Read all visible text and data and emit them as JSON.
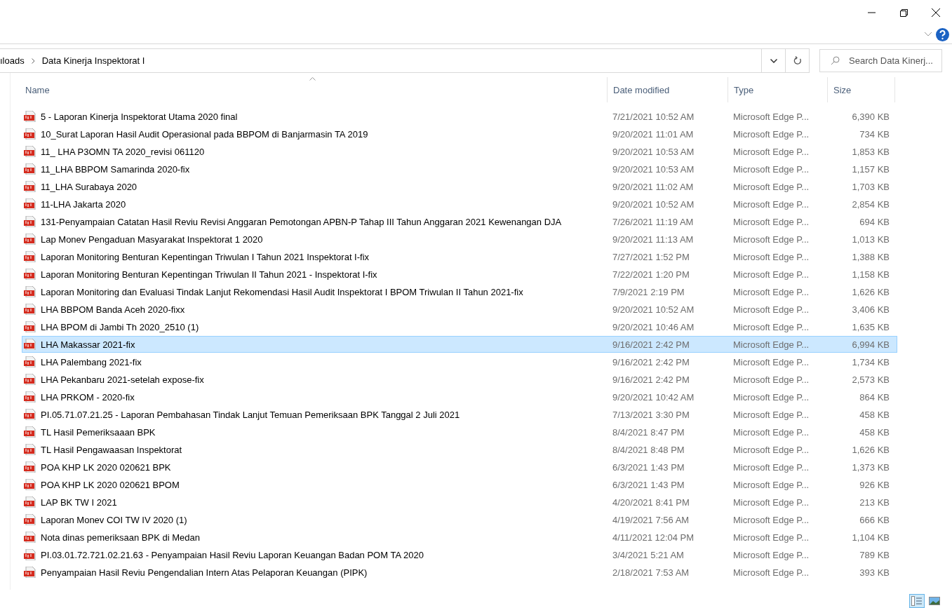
{
  "address_bar": {
    "path": [
      {
        "label": "ıloads"
      },
      {
        "label": "Data Kinerja Inspektorat I"
      }
    ]
  },
  "search": {
    "placeholder": "Search Data Kinerj..."
  },
  "table": {
    "columns": [
      "Name",
      "Date modified",
      "Type",
      "Size"
    ],
    "rows": [
      {
        "name": "5 - Laporan Kinerja Inspektorat Utama 2020 final",
        "date": "7/21/2021 10:52 AM",
        "type": "Microsoft Edge P...",
        "size": "6,390 KB",
        "selected": false
      },
      {
        "name": "10_Surat Laporan Hasil Audit Operasional pada BBPOM di Banjarmasin TA 2019",
        "date": "9/20/2021 11:01 AM",
        "type": "Microsoft Edge P...",
        "size": "734 KB",
        "selected": false
      },
      {
        "name": "11_ LHA P3OMN TA 2020_revisi 061120",
        "date": "9/20/2021 10:53 AM",
        "type": "Microsoft Edge P...",
        "size": "1,853 KB",
        "selected": false
      },
      {
        "name": "11_LHA BBPOM Samarinda 2020-fix",
        "date": "9/20/2021 10:53 AM",
        "type": "Microsoft Edge P...",
        "size": "1,157 KB",
        "selected": false
      },
      {
        "name": "11_LHA Surabaya 2020",
        "date": "9/20/2021 11:02 AM",
        "type": "Microsoft Edge P...",
        "size": "1,703 KB",
        "selected": false
      },
      {
        "name": "11-LHA Jakarta 2020",
        "date": "9/20/2021 10:52 AM",
        "type": "Microsoft Edge P...",
        "size": "2,854 KB",
        "selected": false
      },
      {
        "name": "131-Penyampaian Catatan Hasil Reviu Revisi Anggaran Pemotongan APBN-P Tahap III Tahun Anggaran 2021 Kewenangan DJA",
        "date": "7/26/2021 11:19 AM",
        "type": "Microsoft Edge P...",
        "size": "694 KB",
        "selected": false
      },
      {
        "name": "Lap Monev Pengaduan Masyarakat Inspektorat 1 2020",
        "date": "9/20/2021 11:13 AM",
        "type": "Microsoft Edge P...",
        "size": "1,013 KB",
        "selected": false
      },
      {
        "name": "Laporan Monitoring Benturan Kepentingan Triwulan I Tahun 2021 Inspektorat I-fix",
        "date": "7/27/2021 1:52 PM",
        "type": "Microsoft Edge P...",
        "size": "1,388 KB",
        "selected": false
      },
      {
        "name": "Laporan Monitoring Benturan Kepentingan Triwulan II Tahun 2021 - Inspektorat I-fix",
        "date": "7/22/2021 1:20 PM",
        "type": "Microsoft Edge P...",
        "size": "1,158 KB",
        "selected": false
      },
      {
        "name": "Laporan Monitoring dan Evaluasi Tindak Lanjut Rekomendasi Hasil Audit Inspektorat I BPOM Triwulan II Tahun 2021-fix",
        "date": "7/9/2021 2:19 PM",
        "type": "Microsoft Edge P...",
        "size": "1,626 KB",
        "selected": false
      },
      {
        "name": "LHA BBPOM Banda Aceh 2020-fixx",
        "date": "9/20/2021 10:52 AM",
        "type": "Microsoft Edge P...",
        "size": "3,406 KB",
        "selected": false
      },
      {
        "name": "LHA BPOM di Jambi Th 2020_2510 (1)",
        "date": "9/20/2021 10:46 AM",
        "type": "Microsoft Edge P...",
        "size": "1,635 KB",
        "selected": false
      },
      {
        "name": "LHA Makassar 2021-fix",
        "date": "9/16/2021 2:42 PM",
        "type": "Microsoft Edge P...",
        "size": "6,994 KB",
        "selected": true
      },
      {
        "name": "LHA Palembang 2021-fix",
        "date": "9/16/2021 2:42 PM",
        "type": "Microsoft Edge P...",
        "size": "1,734 KB",
        "selected": false
      },
      {
        "name": "LHA Pekanbaru 2021-setelah expose-fix",
        "date": "9/16/2021 2:42 PM",
        "type": "Microsoft Edge P...",
        "size": "2,573 KB",
        "selected": false
      },
      {
        "name": "LHA PRKOM - 2020-fix",
        "date": "9/20/2021 10:42 AM",
        "type": "Microsoft Edge P...",
        "size": "864 KB",
        "selected": false
      },
      {
        "name": "PI.05.71.07.21.25 - Laporan Pembahasan Tindak Lanjut Temuan Pemeriksaan BPK Tanggal 2 Juli 2021",
        "date": "7/13/2021 3:30 PM",
        "type": "Microsoft Edge P...",
        "size": "458 KB",
        "selected": false
      },
      {
        "name": "TL Hasil Pemeriksaaan BPK",
        "date": "8/4/2021 8:47 PM",
        "type": "Microsoft Edge P...",
        "size": "458 KB",
        "selected": false
      },
      {
        "name": "TL Hasil Pengawaasan Inspektorat",
        "date": "8/4/2021 8:48 PM",
        "type": "Microsoft Edge P...",
        "size": "1,626 KB",
        "selected": false
      },
      {
        "name": "POA KHP LK 2020 020621 BPK",
        "date": "6/3/2021 1:43 PM",
        "type": "Microsoft Edge P...",
        "size": "1,373 KB",
        "selected": false
      },
      {
        "name": "POA KHP LK 2020 020621 BPOM",
        "date": "6/3/2021 1:43 PM",
        "type": "Microsoft Edge P...",
        "size": "926 KB",
        "selected": false
      },
      {
        "name": "LAP BK TW I 2021",
        "date": "4/20/2021 8:41 PM",
        "type": "Microsoft Edge P...",
        "size": "213 KB",
        "selected": false
      },
      {
        "name": "Laporan Monev COI TW IV 2020 (1)",
        "date": "4/19/2021 7:56 AM",
        "type": "Microsoft Edge P...",
        "size": "666 KB",
        "selected": false
      },
      {
        "name": "Nota dinas pemeriksaan BPK di Medan",
        "date": "4/11/2021 12:04 PM",
        "type": "Microsoft Edge P...",
        "size": "1,104 KB",
        "selected": false
      },
      {
        "name": "PI.03.01.72.721.02.21.63 - Penyampaian Hasil Reviu Laporan Keuangan Badan POM TA 2020",
        "date": "3/4/2021 5:21 AM",
        "type": "Microsoft Edge P...",
        "size": "789 KB",
        "selected": false
      },
      {
        "name": "Penyampaian Hasil Reviu Pengendalian Intern Atas Pelaporan Keuangan (PIPK)",
        "date": "2/18/2021 7:53 AM",
        "type": "Microsoft Edge P...",
        "size": "393 KB",
        "selected": false
      }
    ]
  },
  "view_buttons": [
    {
      "kind": "details",
      "selected": true
    },
    {
      "kind": "tiles",
      "selected": false
    }
  ]
}
